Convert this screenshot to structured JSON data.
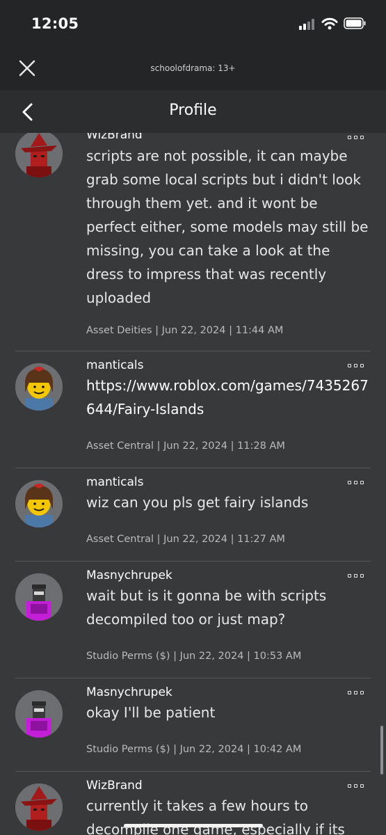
{
  "status_bar": {
    "time": "12:05"
  },
  "web_bar": {
    "site": "schoolofdrama: 13+"
  },
  "nav": {
    "title": "Profile"
  },
  "posts": [
    {
      "author": "WizBrand",
      "text": "scripts are not possible, it can maybe grab some local scripts but i didn't look through them yet. and it wont be perfect either, some models may still be missing, you can take a look at the dress to impress that was recently uploaded",
      "meta": "Asset Deities | Jun 22, 2024 | 11:44 AM"
    },
    {
      "author": "manticals",
      "text": "https://www.roblox.com/games/7435267644/Fairy-Islands",
      "meta": "Asset Central | Jun 22, 2024 | 11:28 AM"
    },
    {
      "author": "manticals",
      "text": "wiz can you pls get fairy islands",
      "meta": "Asset Central | Jun 22, 2024 | 11:27 AM"
    },
    {
      "author": "Masnychrupek",
      "text": "wait but is it gonna be with scripts decompiled too or just map?",
      "meta": "Studio Perms ($) | Jun 22, 2024 | 10:53 AM"
    },
    {
      "author": "Masnychrupek",
      "text": "okay I'll be patient",
      "meta": "Studio Perms ($) | Jun 22, 2024 | 10:42 AM"
    },
    {
      "author": "WizBrand",
      "text": "currently it takes a few hours to decompile one game, especially if its",
      "meta": ""
    }
  ],
  "icons": {
    "close": "close-icon",
    "back": "chevron-left-icon",
    "more": "more-options-icon",
    "signal": "cellular-signal-icon",
    "wifi": "wifi-icon",
    "battery": "battery-icon"
  },
  "colors": {
    "background": "#38393b",
    "header": "#232527",
    "navbar": "#2b2d2f",
    "text": "#e7e7e8",
    "meta_text": "#b9bbbe",
    "divider": "#55575a"
  }
}
